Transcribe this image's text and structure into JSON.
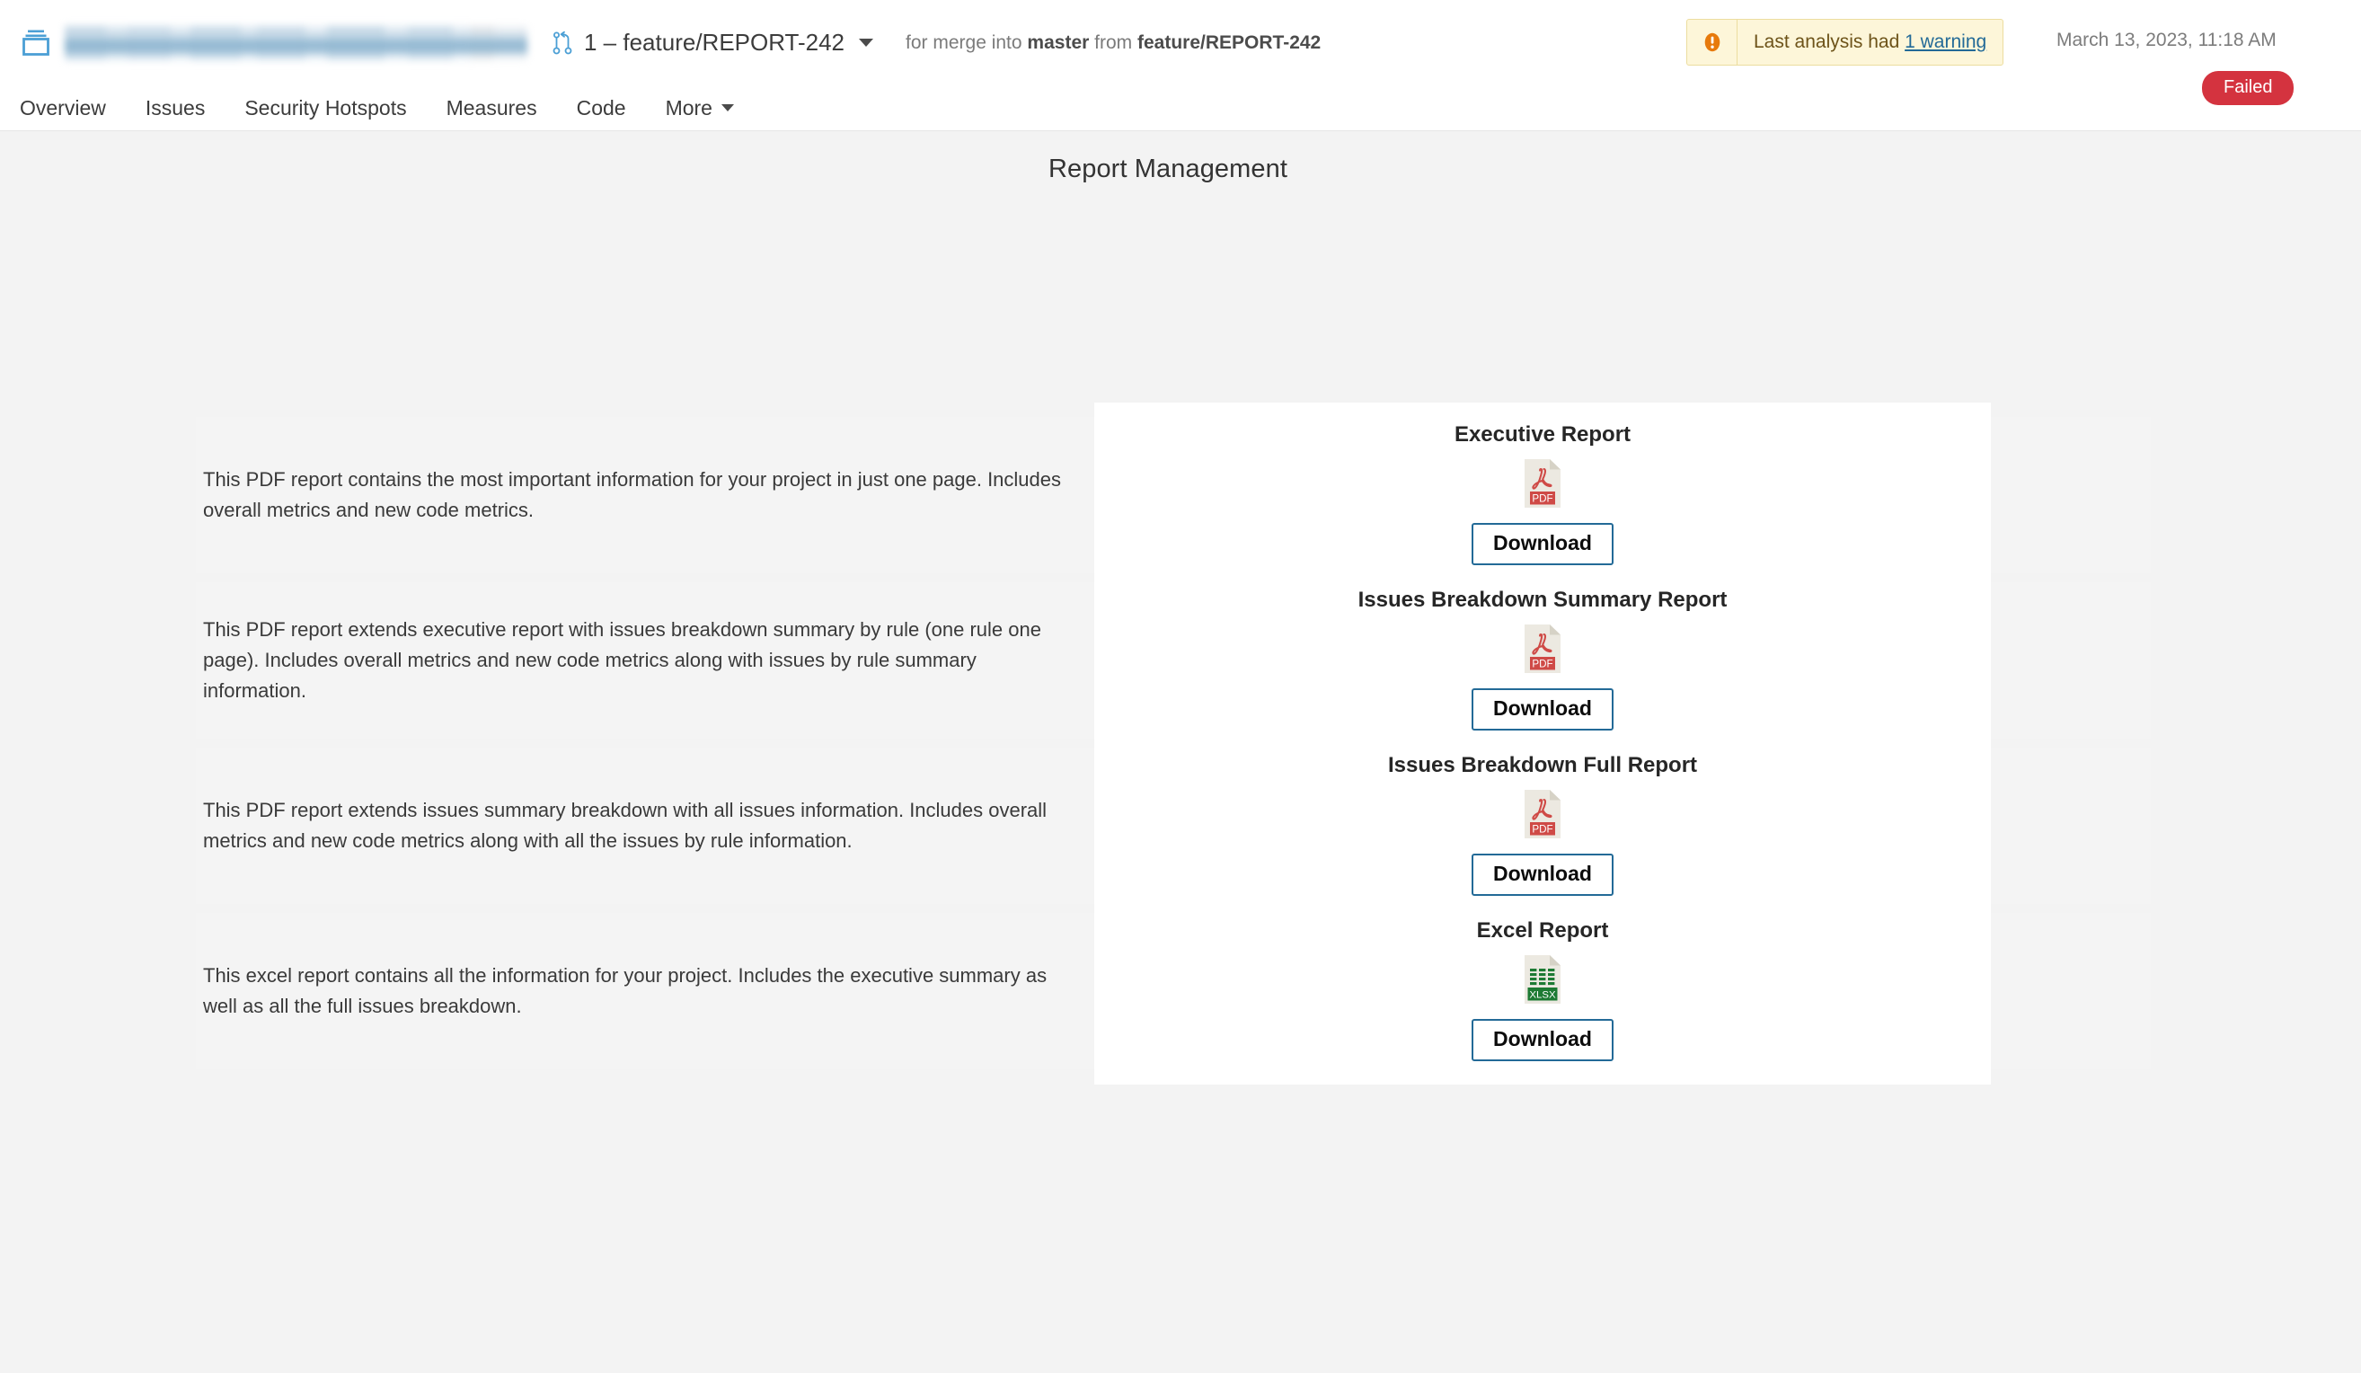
{
  "header": {
    "project_icon": "project-stack-icon",
    "project_name_redacted": true,
    "pull_request_icon": "pull-request-icon",
    "pull_request_label": "1 – feature/REPORT-242",
    "merge_prefix": "for merge into",
    "merge_target": "master",
    "merge_middle": "from",
    "merge_source": "feature/REPORT-242",
    "warning": {
      "icon": "warning-exclamation-icon",
      "text_prefix": "Last analysis had",
      "link_text": "1 warning",
      "bg_color": "#fdf6d9",
      "border_color": "#ecdd9f",
      "icon_color": "#e77a0c"
    },
    "analysis_date": "March 13, 2023, 11:18 AM",
    "quality_gate_status": "Failed",
    "quality_gate_color": "#d4333f",
    "nav_tabs": [
      {
        "label": "Overview"
      },
      {
        "label": "Issues"
      },
      {
        "label": "Security Hotspots"
      },
      {
        "label": "Measures"
      },
      {
        "label": "Code"
      },
      {
        "label": "More",
        "has_caret": true
      }
    ]
  },
  "page": {
    "title": "Report Management",
    "branch_selector": {
      "icon": "pull-request-icon",
      "value": "1 - feature/REPORT-242",
      "caret_icon": "chevron-down-icon"
    },
    "help_icon": "help-circle-icon",
    "annotation_arrow": {
      "icon": "green-arrow-annotation",
      "color": "#00d418"
    }
  },
  "reports": [
    {
      "description": "This PDF report contains the most important information for your project in just one page. Includes overall metrics and new code metrics.",
      "title": "Executive Report",
      "file_icon": "pdf-file-icon",
      "file_type": "PDF",
      "download_label": "Download"
    },
    {
      "description": "This PDF report extends executive report with issues breakdown summary by rule (one rule one page). Includes overall metrics and new code metrics along with issues by rule summary information.",
      "title": "Issues Breakdown Summary Report",
      "file_icon": "pdf-file-icon",
      "file_type": "PDF",
      "download_label": "Download"
    },
    {
      "description": "This PDF report extends issues summary breakdown with all issues information. Includes overall metrics and new code metrics along with all the issues by rule information.",
      "title": "Issues Breakdown Full Report",
      "file_icon": "pdf-file-icon",
      "file_type": "PDF",
      "download_label": "Download"
    },
    {
      "description": "This excel report contains all the information for your project. Includes the executive summary as well as all the full issues breakdown.",
      "title": "Excel Report",
      "file_icon": "xlsx-file-icon",
      "file_type": "XLSX",
      "download_label": "Download"
    }
  ],
  "colors": {
    "page_bg": "#f3f3f3",
    "section_bg": "#f4f4f4",
    "card_bg": "#ffffff",
    "accent_blue": "#236a97",
    "link_blue": "#236a97",
    "pdf_red": "#cf4a46",
    "xlsx_green": "#1d7a33"
  }
}
